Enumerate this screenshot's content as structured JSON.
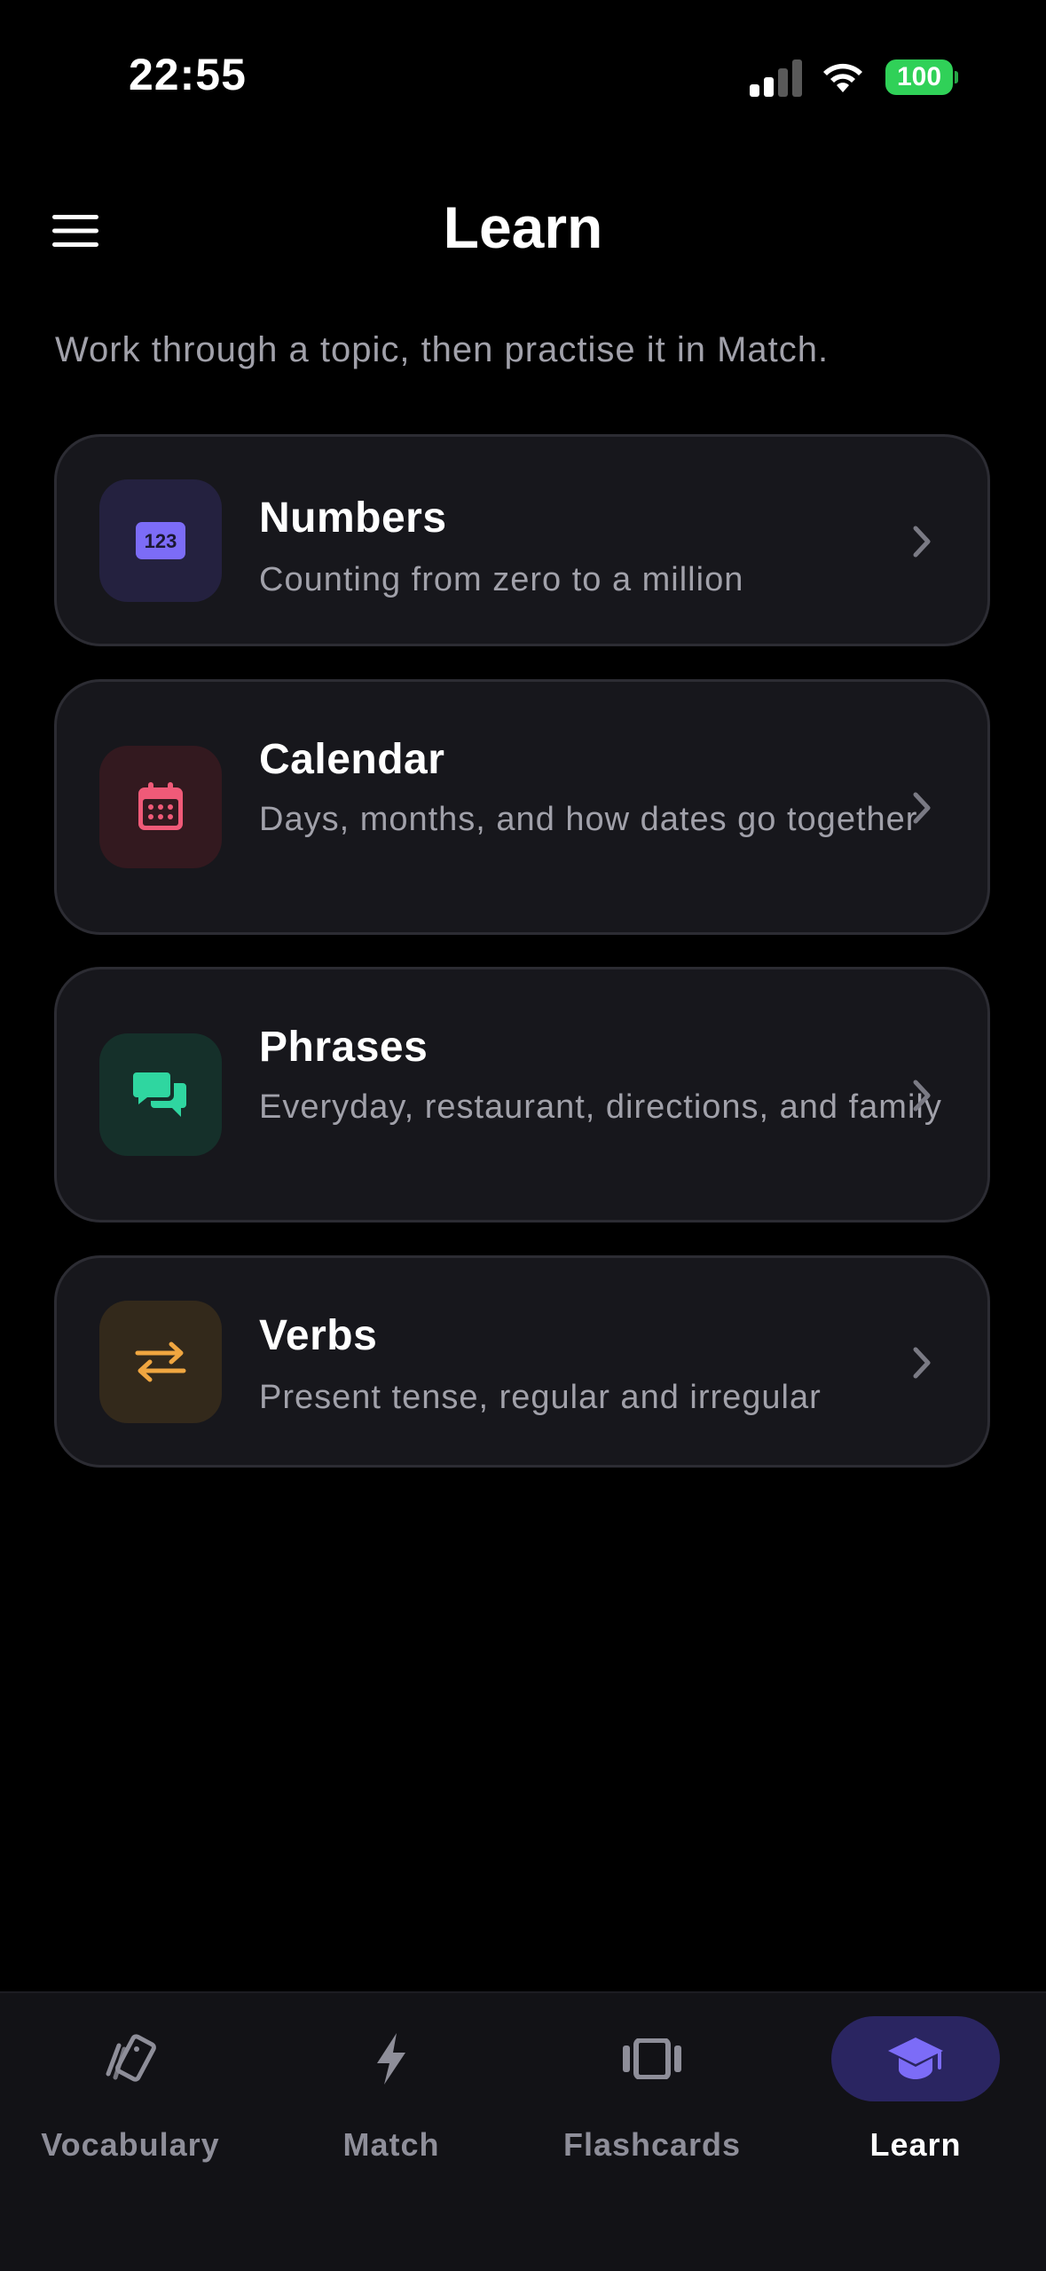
{
  "status_bar": {
    "time": "22:55",
    "battery": "100"
  },
  "header": {
    "menu_icon": "hamburger-menu-icon",
    "title": "Learn",
    "subtitle": "Work through a topic, then practise it in Match."
  },
  "topics": [
    {
      "title": "Numbers",
      "description": "Counting from zero to a million",
      "icon": "numbers-123-icon",
      "icon_text": "123",
      "accent": "#7c6cf7",
      "icon_bg": "#24213f"
    },
    {
      "title": "Calendar",
      "description": "Days, months, and how dates go together",
      "icon": "calendar-icon",
      "accent": "#f05a78",
      "icon_bg": "#33191f"
    },
    {
      "title": "Phrases",
      "description": "Everyday, restaurant, directions, and family",
      "icon": "chat-bubbles-icon",
      "accent": "#2fd6a0",
      "icon_bg": "#15302a"
    },
    {
      "title": "Verbs",
      "description": "Present tense, regular and irregular",
      "icon": "swap-arrows-icon",
      "accent": "#f0a640",
      "icon_bg": "#33291b"
    }
  ],
  "tab_bar": {
    "active_tab": "Learn",
    "active_color": "#2a2561",
    "tabs": [
      {
        "label": "Vocabulary",
        "icon": "cards-icon"
      },
      {
        "label": "Match",
        "icon": "lightning-icon"
      },
      {
        "label": "Flashcards",
        "icon": "carousel-icon"
      },
      {
        "label": "Learn",
        "icon": "graduation-cap-icon"
      }
    ]
  }
}
